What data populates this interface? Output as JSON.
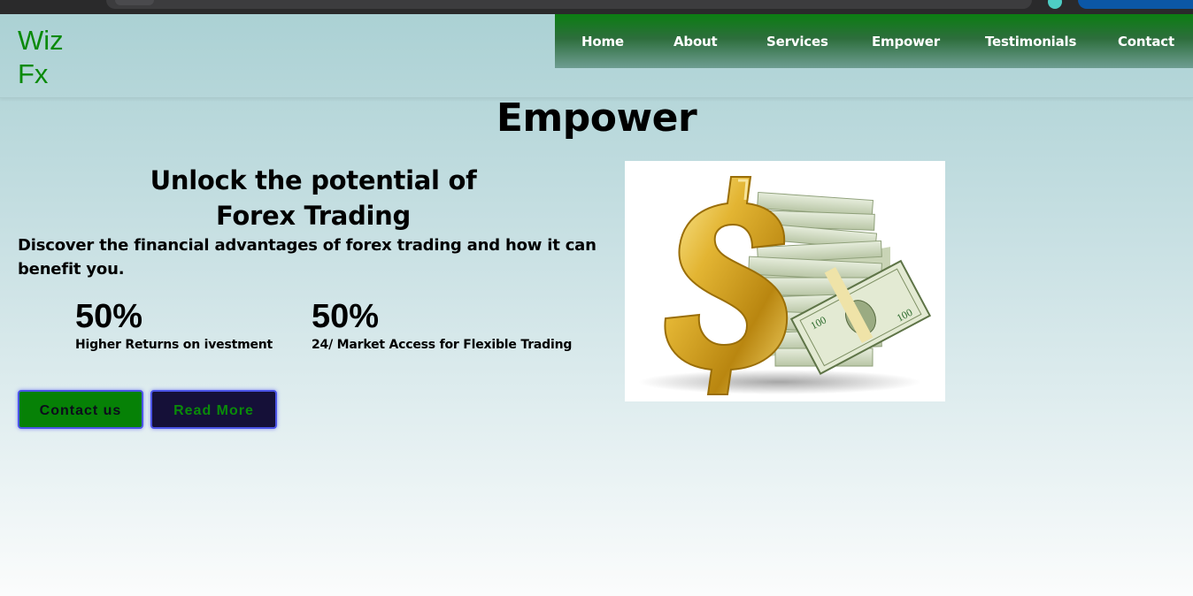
{
  "logo": {
    "line1": "Wiz",
    "line2": "Fx"
  },
  "nav": {
    "items": [
      {
        "label": "Home"
      },
      {
        "label": "About"
      },
      {
        "label": "Services"
      },
      {
        "label": "Empower"
      },
      {
        "label": "Testimonials"
      },
      {
        "label": "Contact"
      }
    ]
  },
  "page": {
    "title": "Empower"
  },
  "hero": {
    "headline_line1": "Unlock the potential of",
    "headline_line2": "Forex Trading",
    "subtext": "Discover the financial advantages of forex trading and how it can benefit you.",
    "image_icon": "money-dollar-icon"
  },
  "stats": [
    {
      "value": "50%",
      "label": "Higher Returns on ivestment"
    },
    {
      "value": "50%",
      "label": "24/ Market Access for Flexible Trading"
    }
  ],
  "buttons": {
    "contact": "Contact us",
    "read_more": "Read More"
  },
  "colors": {
    "brand_green": "#0a8a0a",
    "nav_gradient_top": "#0b7e12",
    "button_dark": "#151038",
    "button_border": "#4b54e6"
  }
}
